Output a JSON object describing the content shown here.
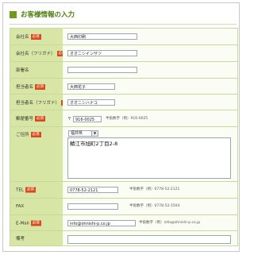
{
  "header": {
    "title": "お客様情報の入力"
  },
  "required_label": "必須",
  "fields": {
    "company": {
      "label": "会社名",
      "value": "大西印刷"
    },
    "company_kana": {
      "label": "会社名（フリガナ）",
      "value": "オオニシインサツ"
    },
    "department": {
      "label": "部署名",
      "value": ""
    },
    "person": {
      "label": "担当者名",
      "value": "大西花子"
    },
    "person_kana": {
      "label": "担当者名（フリガナ）",
      "value": "オオニシハナコ"
    },
    "zip": {
      "label": "郵便番号",
      "prefix": "〒",
      "value": "916-0025",
      "note": "半角数字（例）916-0025"
    },
    "address": {
      "label": "ご住所",
      "prefecture": "福井県",
      "value": "鯖江市旭町2丁目2-8"
    },
    "tel": {
      "label": "TEL",
      "value": "0778-52-2121",
      "note": "半角数字（例）0778-52-2121"
    },
    "fax": {
      "label": "FAX",
      "value": "",
      "note": "半角数字（例）0778-52-1504"
    },
    "email": {
      "label": "E-Mail",
      "value": "info@ohnishi-p.co.jp",
      "note": "半角数字（例）info@ohnishi-p.co.jp"
    },
    "remarks": {
      "label": "備考",
      "value": ""
    }
  }
}
